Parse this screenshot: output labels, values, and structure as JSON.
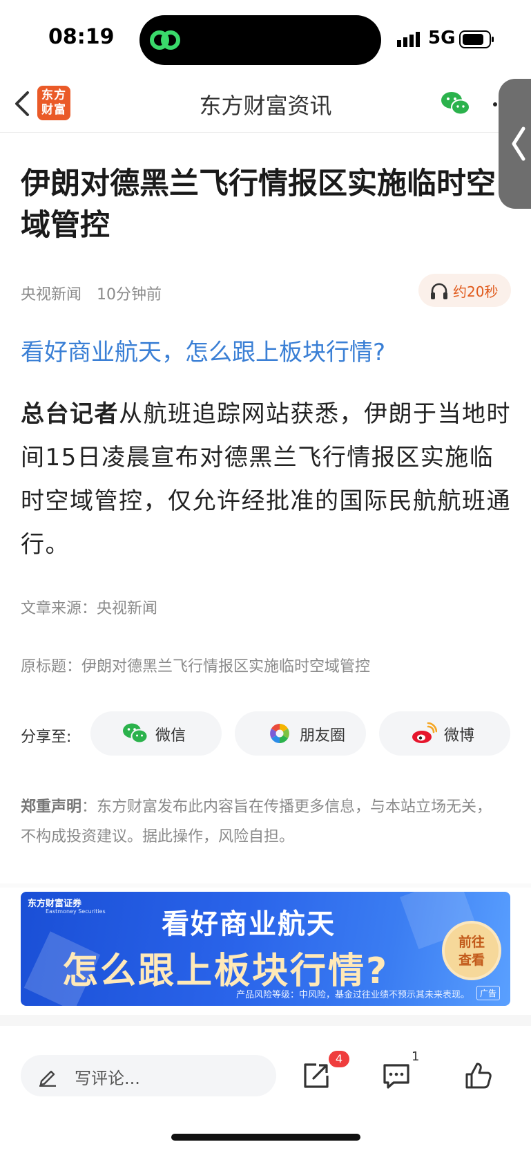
{
  "status": {
    "time": "08:19",
    "network": "5G"
  },
  "nav": {
    "logo_line1": "东方",
    "logo_line2": "财富",
    "title": "东方财富资讯"
  },
  "article": {
    "headline": "伊朗对德黑兰飞行情报区实施临时空域管控",
    "source": "央视新闻",
    "time_ago": "10分钟前",
    "audio_label": "约20秒",
    "promo_link": "看好商业航天，怎么跟上板块行情?",
    "body_lead": "总台记者",
    "body_rest": "从航班追踪网站获悉，伊朗于当地时间15日凌晨宣布对德黑兰飞行情报区实施临时空域管控，仅允许经批准的国际民航航班通行。",
    "article_source": "文章来源：央视新闻",
    "original_title": "原标题：伊朗对德黑兰飞行情报区实施临时空域管控"
  },
  "share": {
    "label": "分享至:",
    "targets": [
      {
        "label": "微信",
        "icon": "wechat-icon"
      },
      {
        "label": "朋友圈",
        "icon": "moments-icon"
      },
      {
        "label": "微博",
        "icon": "weibo-icon"
      }
    ]
  },
  "disclaimer": {
    "lead": "郑重声明",
    "text": "：东方财富发布此内容旨在传播更多信息，与本站立场无关，不构成投资建议。据此操作，风险自担。"
  },
  "ad": {
    "brand": "东方财富证券",
    "brand_en": "Eastmoney Securities",
    "line1": "看好商业航天",
    "line2": "怎么跟上板块行情?",
    "cta_line1": "前往",
    "cta_line2": "查看",
    "risk": "产品风险等级：中风险，基金过往业绩不预示其未来表现。",
    "tag": "广告"
  },
  "bottom": {
    "comment_placeholder": "写评论...",
    "share_badge": "4",
    "comment_count": "1"
  },
  "colors": {
    "accent_blue": "#3a7fd5",
    "brand_orange": "#ea5a28",
    "badge_red": "#ef3d3d"
  }
}
